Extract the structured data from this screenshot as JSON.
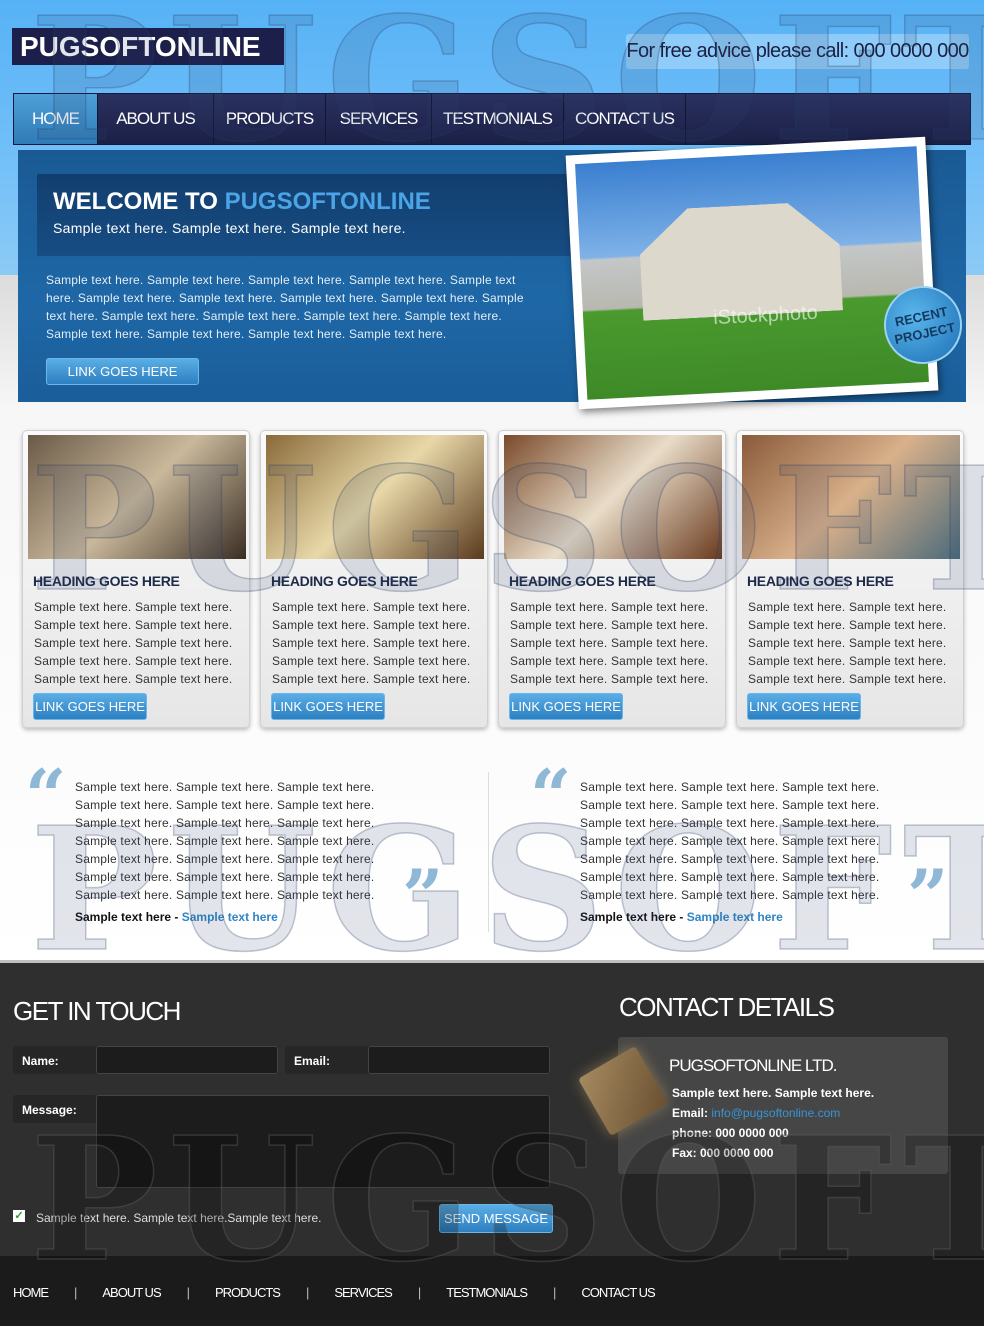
{
  "header": {
    "logo": "PUGSOFTONLINE",
    "phone": "For free advice please call: 000 0000 000",
    "watermark": "PUGSOFT"
  },
  "nav": {
    "items": [
      "HOME",
      "ABOUT US",
      "PRODUCTS",
      "SERVICES",
      "TESTMONIALS",
      "CONTACT US"
    ],
    "active": "HOME"
  },
  "banner": {
    "title_prefix": "WELCOME TO ",
    "title_brand": "PUGSOFTONLINE",
    "subtitle": "Sample text here. Sample text here. Sample text here.",
    "body": "Sample text here. Sample text here. Sample text here. Sample text here. Sample text here. Sample text here. Sample text here. Sample text here. Sample text here. Sample text here. Sample text here. Sample text here. Sample text here. Sample text here. Sample text here. Sample text here. Sample text here. Sample text here.",
    "link": "LINK GOES HERE",
    "badge": "RECENT PROJECT",
    "photo_watermark": "iStockphoto"
  },
  "cards": [
    {
      "heading": "HEADING GOES HERE",
      "text": "Sample text here. Sample text here. Sample text here. Sample text here. Sample text here. Sample text here. Sample text here. Sample text here. Sample text here. Sample text here.",
      "link": "LINK GOES HERE"
    },
    {
      "heading": "HEADING GOES HERE",
      "text": "Sample text here. Sample text here. Sample text here. Sample text here. Sample text here. Sample text here. Sample text here. Sample text here. Sample text here. Sample text here.",
      "link": "LINK GOES HERE"
    },
    {
      "heading": "HEADING GOES HERE",
      "text": "Sample text here. Sample text here. Sample text here. Sample text here. Sample text here. Sample text here. Sample text here. Sample text here. Sample text here. Sample text here.",
      "link": "LINK GOES HERE"
    },
    {
      "heading": "HEADING GOES HERE",
      "text": "Sample text here. Sample text here. Sample text here. Sample text here. Sample text here. Sample text here. Sample text here. Sample text here. Sample text here. Sample text here.",
      "link": "LINK GOES HERE"
    }
  ],
  "testimonials": [
    {
      "text": "Sample text here. Sample text here. Sample text here. Sample text here. Sample text here. Sample text here. Sample text here. Sample text here. Sample text here. Sample text here. Sample text here. Sample text here. Sample text here. Sample text here. Sample text here. Sample text here. Sample text here. Sample text here. Sample text here. Sample text here. Sample text here.",
      "author": "Sample text here",
      "sep": " - ",
      "source": "Sample text here"
    },
    {
      "text": "Sample text here. Sample text here. Sample text here. Sample text here. Sample text here. Sample text here. Sample text here. Sample text here. Sample text here. Sample text here. Sample text here. Sample text here. Sample text here. Sample text here. Sample text here. Sample text here. Sample text here. Sample text here. Sample text here. Sample text here. Sample text here.",
      "author": "Sample text here",
      "sep": " - ",
      "source": "Sample text here"
    }
  ],
  "contact_form": {
    "title": "GET IN TOUCH",
    "name_label": "Name:",
    "email_label": "Email:",
    "message_label": "Message:",
    "checkbox_label": "Sample text here. Sample text here.Sample text here.",
    "checkbox_checked": true,
    "send": "SEND MESSAGE"
  },
  "contact_details": {
    "title": "CONTACT DETAILS",
    "company": "PUGSOFTONLINE LTD.",
    "line": "Sample text here. Sample text here.",
    "email_label": "Email: ",
    "email": "info@pugsoftonline.com",
    "phone": "phone: 000 0000 000",
    "fax": "Fax: 000 0000 000"
  },
  "footer_nav": [
    "HOME",
    "ABOUT US",
    "PRODUCTS",
    "SERVICES",
    "TESTMONIALS",
    "CONTACT US"
  ],
  "colors": {
    "navy": "#1b1f4a",
    "accent": "#2e85c6",
    "footer": "#2f2f2f"
  }
}
